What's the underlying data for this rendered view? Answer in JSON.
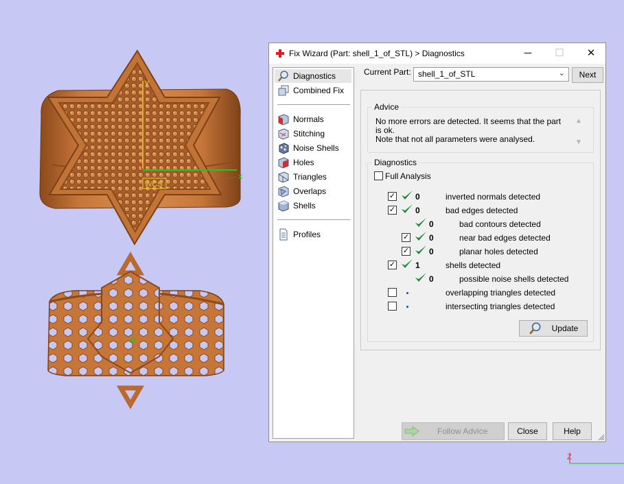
{
  "scene": {
    "wcs_label": "WCS",
    "axis_y": "y",
    "axis_x": "x",
    "corner_axis_z": "Z"
  },
  "dialog": {
    "title": "Fix Wizard (Part: shell_1_of_STL) > Diagnostics",
    "controls": {
      "minimize": "─",
      "maximize": "☐",
      "close": "✕"
    }
  },
  "nav": {
    "group1": [
      {
        "label": "Diagnostics",
        "icon": "magnifier-icon",
        "selected": true
      },
      {
        "label": "Combined Fix",
        "icon": "stacked-cubes-icon"
      }
    ],
    "group2": [
      {
        "label": "Normals",
        "icon": "normals-cube-icon"
      },
      {
        "label": "Stitching",
        "icon": "stitching-cube-icon"
      },
      {
        "label": "Noise Shells",
        "icon": "noise-shells-icon"
      },
      {
        "label": "Holes",
        "icon": "holes-cube-icon"
      },
      {
        "label": "Triangles",
        "icon": "triangles-cube-icon"
      },
      {
        "label": "Overlaps",
        "icon": "overlaps-cube-icon"
      },
      {
        "label": "Shells",
        "icon": "shells-cube-icon"
      }
    ],
    "group3": [
      {
        "label": "Profiles",
        "icon": "document-icon"
      }
    ]
  },
  "current_part": {
    "label": "Current Part:",
    "value": "shell_1_of_STL",
    "next_label": "Next"
  },
  "advice": {
    "title": "Advice",
    "line1": "No more errors are detected. It seems that the part is ok.",
    "line2": "Note that not all parameters were analysed."
  },
  "diagnostics": {
    "title": "Diagnostics",
    "full_analysis_label": "Full Analysis",
    "full_analysis_checked": false,
    "rows": [
      {
        "checkbox": true,
        "checked": true,
        "status": "ok",
        "count": "0",
        "text": "inverted normals detected",
        "indent": 0
      },
      {
        "checkbox": true,
        "checked": true,
        "status": "ok",
        "count": "0",
        "text": "bad edges detected",
        "indent": 0
      },
      {
        "checkbox": false,
        "checked": false,
        "status": "ok",
        "count": "0",
        "text": "bad contours detected",
        "indent": 1
      },
      {
        "checkbox": true,
        "checked": true,
        "status": "ok",
        "count": "0",
        "text": "near bad edges detected",
        "indent": 1
      },
      {
        "checkbox": true,
        "checked": true,
        "status": "ok",
        "count": "0",
        "text": "planar holes detected",
        "indent": 1
      },
      {
        "checkbox": true,
        "checked": true,
        "status": "ok",
        "count": "1",
        "text": "shells detected",
        "indent": 0
      },
      {
        "checkbox": false,
        "checked": false,
        "status": "ok",
        "count": "0",
        "text": "possible noise shells detected",
        "indent": 1
      },
      {
        "checkbox": true,
        "checked": false,
        "status": "none",
        "count": "",
        "text": "overlapping triangles detected",
        "indent": 0
      },
      {
        "checkbox": true,
        "checked": false,
        "status": "none",
        "count": "",
        "text": "intersecting triangles detected",
        "indent": 0
      }
    ],
    "update_label": "Update"
  },
  "footer": {
    "follow_advice_label": "Follow Advice",
    "close_label": "Close",
    "help_label": "Help"
  },
  "colors": {
    "viewport_bg": "#c8c8f4",
    "ring_bronze": "#c8773a",
    "check_green": "#1f8a3a",
    "axis_green": "#22c322",
    "axis_yellow": "#e8d02a"
  }
}
